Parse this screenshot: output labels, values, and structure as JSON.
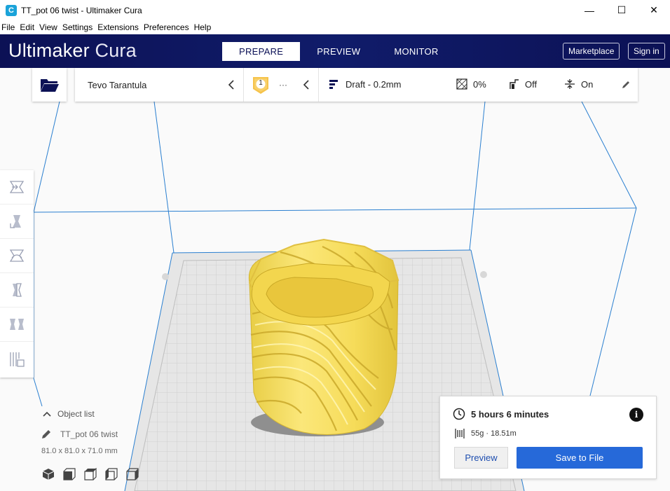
{
  "window": {
    "title": "TT_pot 06 twist - Ultimaker Cura",
    "app_icon_letter": "C",
    "minimize_glyph": "—",
    "maximize_glyph": "☐",
    "close_glyph": "✕"
  },
  "menubar": {
    "items": [
      "File",
      "Edit",
      "View",
      "Settings",
      "Extensions",
      "Preferences",
      "Help"
    ]
  },
  "header": {
    "brand_bold": "Ultimaker",
    "brand_light": "Cura",
    "tabs": [
      "PREPARE",
      "PREVIEW",
      "MONITOR"
    ],
    "active_tab": "PREPARE",
    "marketplace_label": "Marketplace",
    "signin_label": "Sign in",
    "colors": {
      "bar": "#0c1155",
      "active_tab_text": "#0a0f55"
    }
  },
  "toolbar": {
    "printer_name": "Tevo Tarantula",
    "extruder_number": "1",
    "material_dots": "···",
    "profile": "Draft - 0.2mm",
    "infill": "0%",
    "support": "Off",
    "adhesion": "On",
    "icons": [
      "folder-icon",
      "chevron-left-icon",
      "extruder-badge-icon",
      "profile-icon",
      "infill-icon",
      "support-icon",
      "adhesion-icon",
      "pencil-icon"
    ]
  },
  "left_tools": {
    "items": [
      "move-tool-icon",
      "scale-tool-icon",
      "rotate-tool-icon",
      "mirror-tool-icon",
      "per-model-settings-icon",
      "support-blocker-icon"
    ]
  },
  "object_list": {
    "header": "Object list",
    "object_name": "TT_pot 06 twist",
    "dimensions": "81.0 x 81.0 x 71.0 mm",
    "view_icons": [
      "3d-view-icon",
      "front-view-icon",
      "top-view-icon",
      "left-view-icon",
      "right-view-icon"
    ]
  },
  "print_info": {
    "time": "5 hours 6 minutes",
    "material": "55g · 18.51m",
    "info_glyph": "i",
    "preview_label": "Preview",
    "save_label": "Save to File",
    "colors": {
      "save_button": "#2669d9",
      "model": "#f7e267"
    }
  }
}
